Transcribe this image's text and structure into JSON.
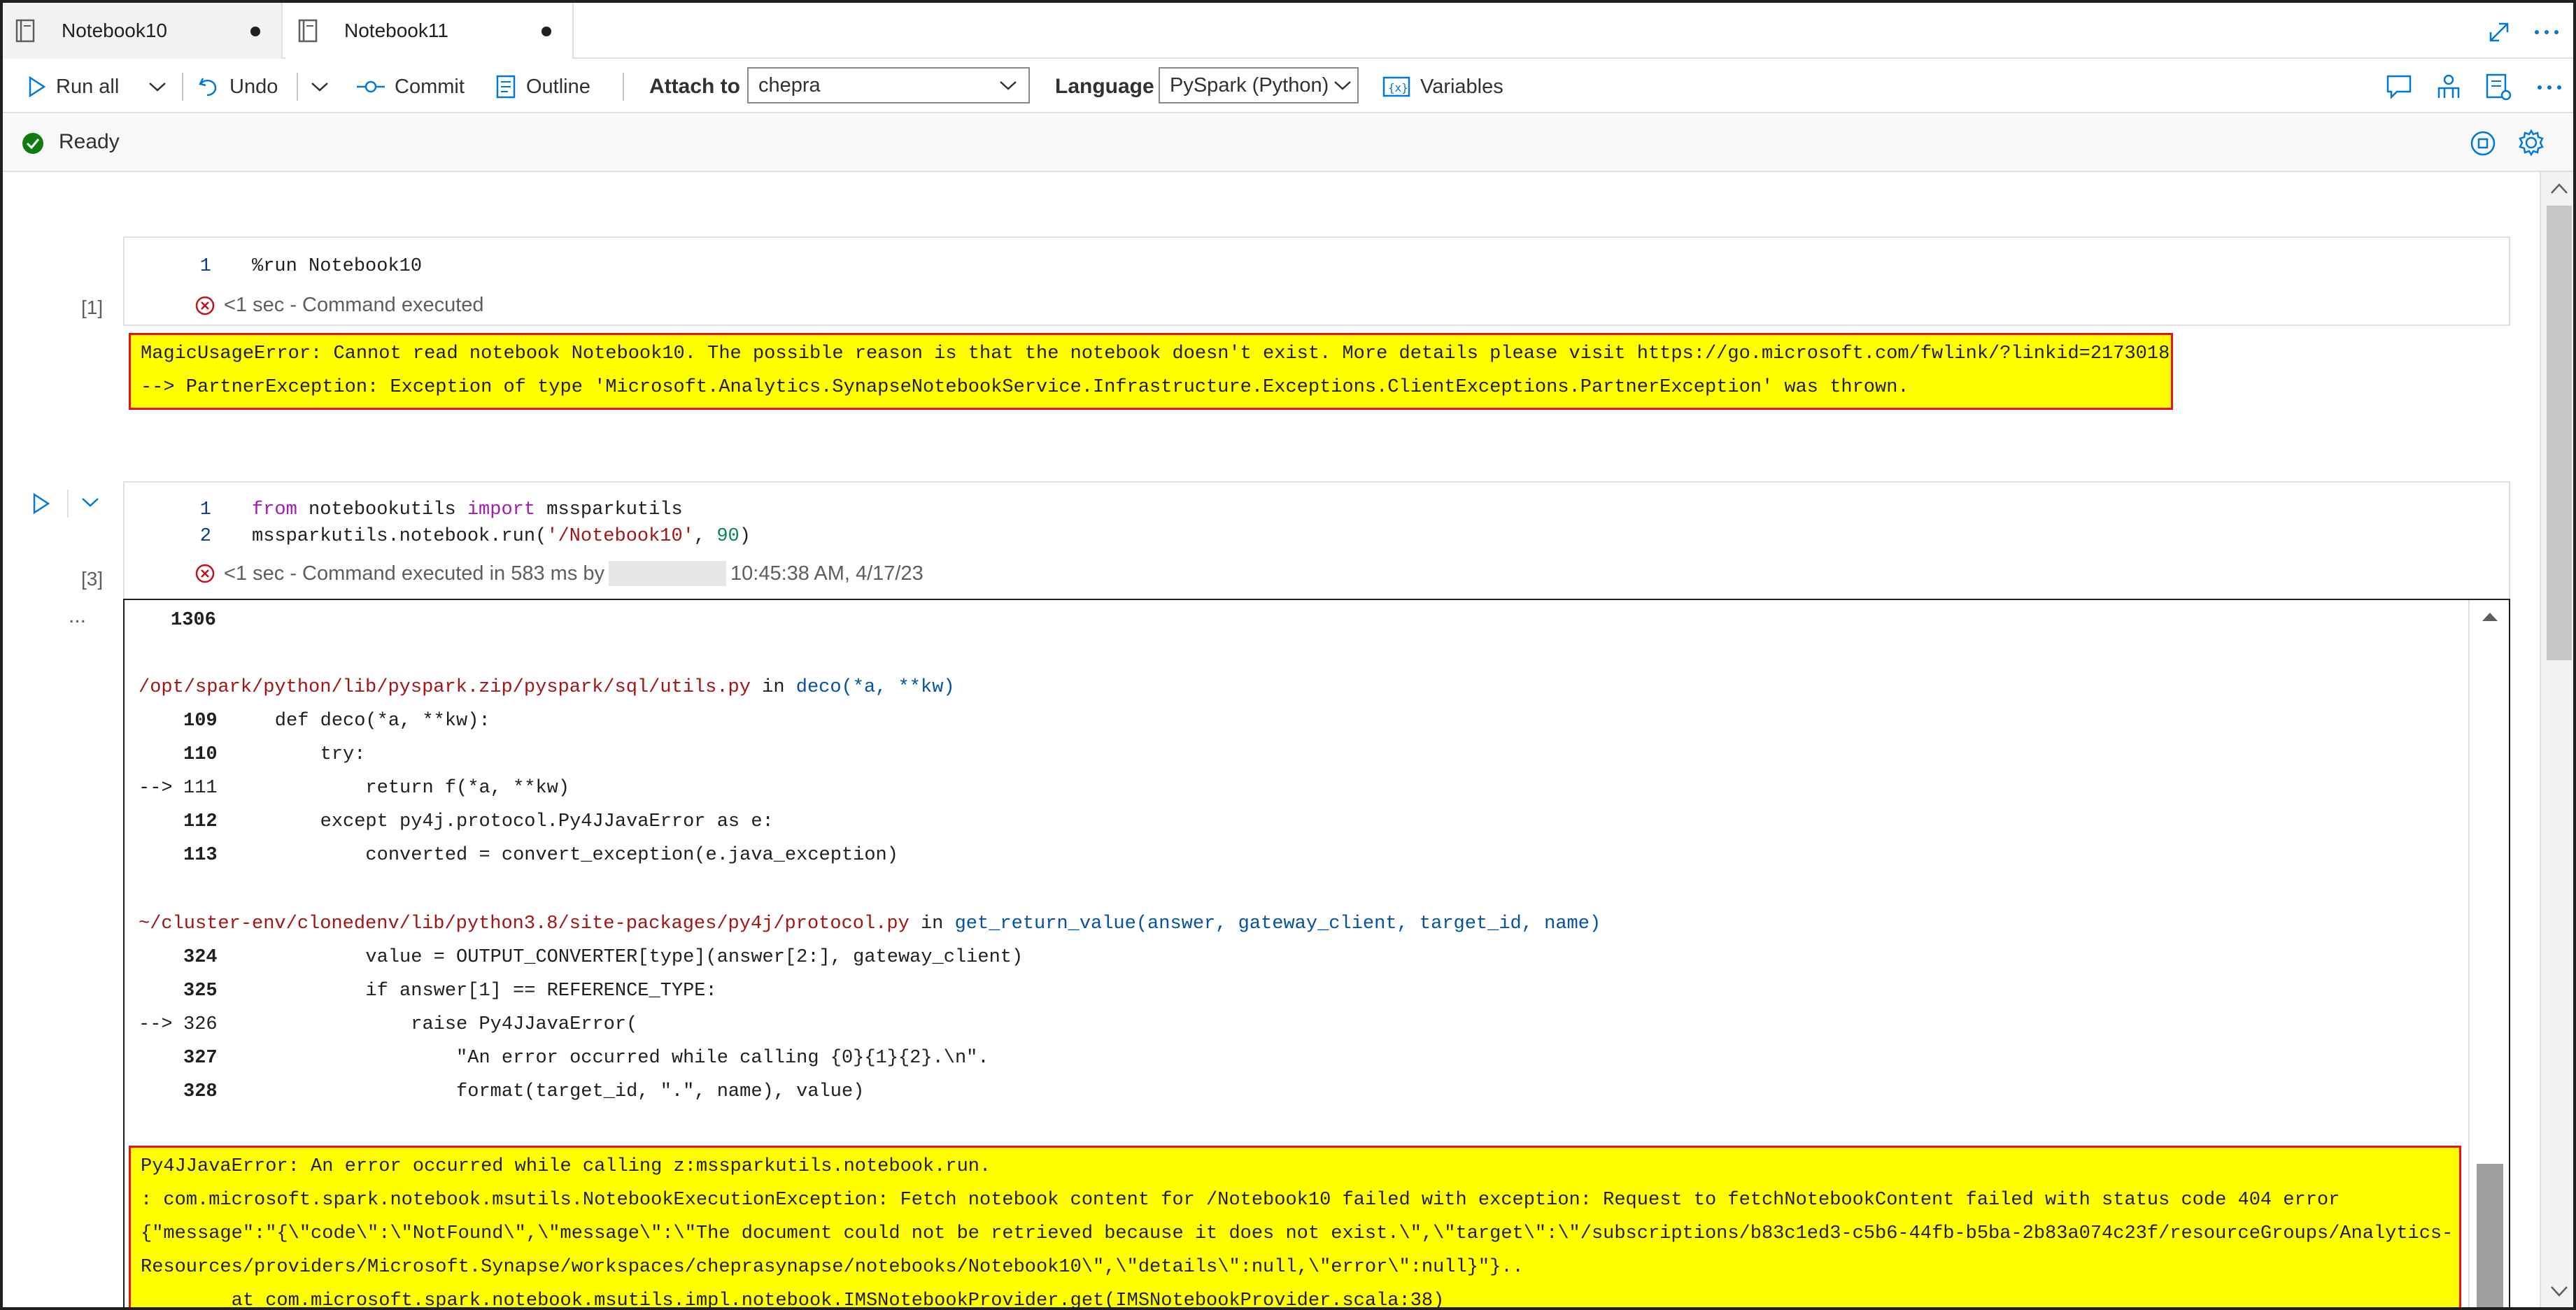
{
  "tabs": [
    {
      "label": "Notebook10",
      "unsaved": true,
      "active": false
    },
    {
      "label": "Notebook11",
      "unsaved": true,
      "active": true
    }
  ],
  "toolbar": {
    "run_all": "Run all",
    "undo": "Undo",
    "commit": "Commit",
    "outline": "Outline",
    "attach_to_label": "Attach to",
    "attach_to_value": "chepra",
    "language_label": "Language",
    "language_value": "PySpark (Python)",
    "variables": "Variables"
  },
  "status": {
    "text": "Ready"
  },
  "cells": [
    {
      "exec_count": "[1]",
      "code_lines": [
        {
          "num": "1",
          "text": "%run Notebook10"
        }
      ],
      "exec_time": "<1 sec",
      "exec_status": "- Command executed",
      "error_lines": [
        "MagicUsageError: Cannot read notebook Notebook10. The possible reason is that the notebook doesn't exist. More details please visit https://go.microsoft.com/fwlink/?linkid=2173018",
        "--> PartnerException: Exception of type 'Microsoft.Analytics.SynapseNotebookService.Infrastructure.Exceptions.ClientExceptions.PartnerException' was thrown."
      ]
    },
    {
      "exec_count": "[3]",
      "code_lines": [
        {
          "num": "1",
          "kw1": "from",
          "mid1": " notebookutils ",
          "kw2": "import",
          "rest": " mssparkutils"
        },
        {
          "num": "2",
          "pre": "mssparkutils.notebook.run(",
          "str": "'/Notebook10'",
          "sep": ", ",
          "num_val": "90",
          "post": ")"
        }
      ],
      "exec_time": "<1 sec",
      "exec_status": "- Command executed in 583 ms by",
      "exec_timestamp": "10:45:38 AM, 4/17/23",
      "more": "...",
      "output": {
        "top_num": "1306",
        "file1_path": "/opt/spark/python/lib/pyspark.zip/pyspark/sql/utils.py",
        "file1_in": " in ",
        "file1_func": "deco",
        "file1_args": "(*a, **kw)",
        "tb1": [
          {
            "marker": "",
            "num": "109",
            "code": "    def deco(*a, **kw):"
          },
          {
            "marker": "",
            "num": "110",
            "code": "        try:"
          },
          {
            "marker": "--> ",
            "num": "111",
            "code": "            return f(*a, **kw)"
          },
          {
            "marker": "",
            "num": "112",
            "code": "        except py4j.protocol.Py4JJavaError as e:"
          },
          {
            "marker": "",
            "num": "113",
            "code": "            converted = convert_exception(e.java_exception)"
          }
        ],
        "file2_path": "~/cluster-env/clonedenv/lib/python3.8/site-packages/py4j/protocol.py",
        "file2_in": " in ",
        "file2_func": "get_return_value",
        "file2_args": "(answer, gateway_client, target_id, name)",
        "tb2": [
          {
            "marker": "",
            "num": "324",
            "code": "            value = OUTPUT_CONVERTER[type](answer[2:], gateway_client)"
          },
          {
            "marker": "",
            "num": "325",
            "code": "            if answer[1] == REFERENCE_TYPE:"
          },
          {
            "marker": "--> ",
            "num": "326",
            "code": "                raise Py4JJavaError("
          },
          {
            "marker": "",
            "num": "327",
            "code": "                    \"An error occurred while calling {0}{1}{2}.\\n\"."
          },
          {
            "marker": "",
            "num": "328",
            "code": "                    format(target_id, \".\", name), value)"
          }
        ],
        "error_lines": [
          "Py4JJavaError: An error occurred while calling z:mssparkutils.notebook.run.",
          ": com.microsoft.spark.notebook.msutils.NotebookExecutionException: Fetch notebook content for /Notebook10 failed with exception: Request to fetchNotebookContent failed with status code 404 error",
          "{\"message\":\"{\\\"code\\\":\\\"NotFound\\\",\\\"message\\\":\\\"The document could not be retrieved because it does not exist.\\\",\\\"target\\\":\\\"/subscriptions/b83c1ed3-c5b6-44fb-b5ba-2b83a074c23f/resourceGroups/Analytics-",
          "Resources/providers/Microsoft.Synapse/workspaces/cheprasynapse/notebooks/Notebook10\\\",\\\"details\\\":null,\\\"error\\\":null}\"}..",
          "        at com.microsoft.spark.notebook.msutils.impl.notebook.IMSNotebookProvider.get(IMSNotebookProvider.scala:38)"
        ]
      }
    }
  ],
  "colors": {
    "error_highlight": "#ffff00",
    "error_border": "#e81123",
    "ready_green": "#107c10",
    "accent_blue": "#0078d4"
  }
}
